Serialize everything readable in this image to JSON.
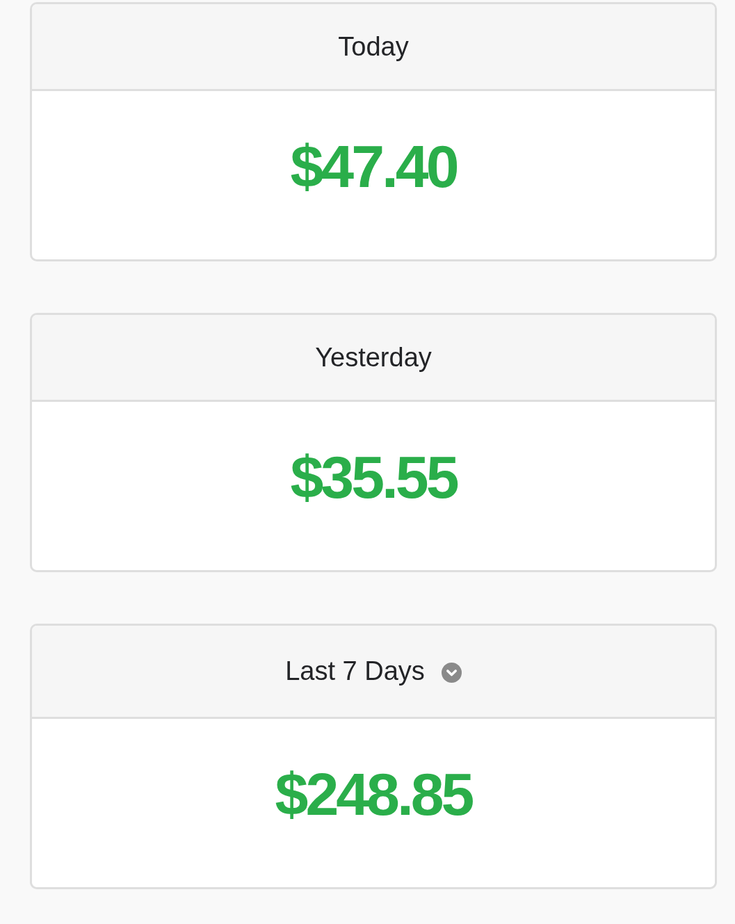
{
  "cards": [
    {
      "kind": "plain",
      "title": "Today",
      "amount": "$47.40"
    },
    {
      "kind": "plain",
      "title": "Yesterday",
      "amount": "$35.55"
    },
    {
      "kind": "dropdown",
      "title": "Last 7 Days",
      "amount": "$248.85"
    }
  ]
}
